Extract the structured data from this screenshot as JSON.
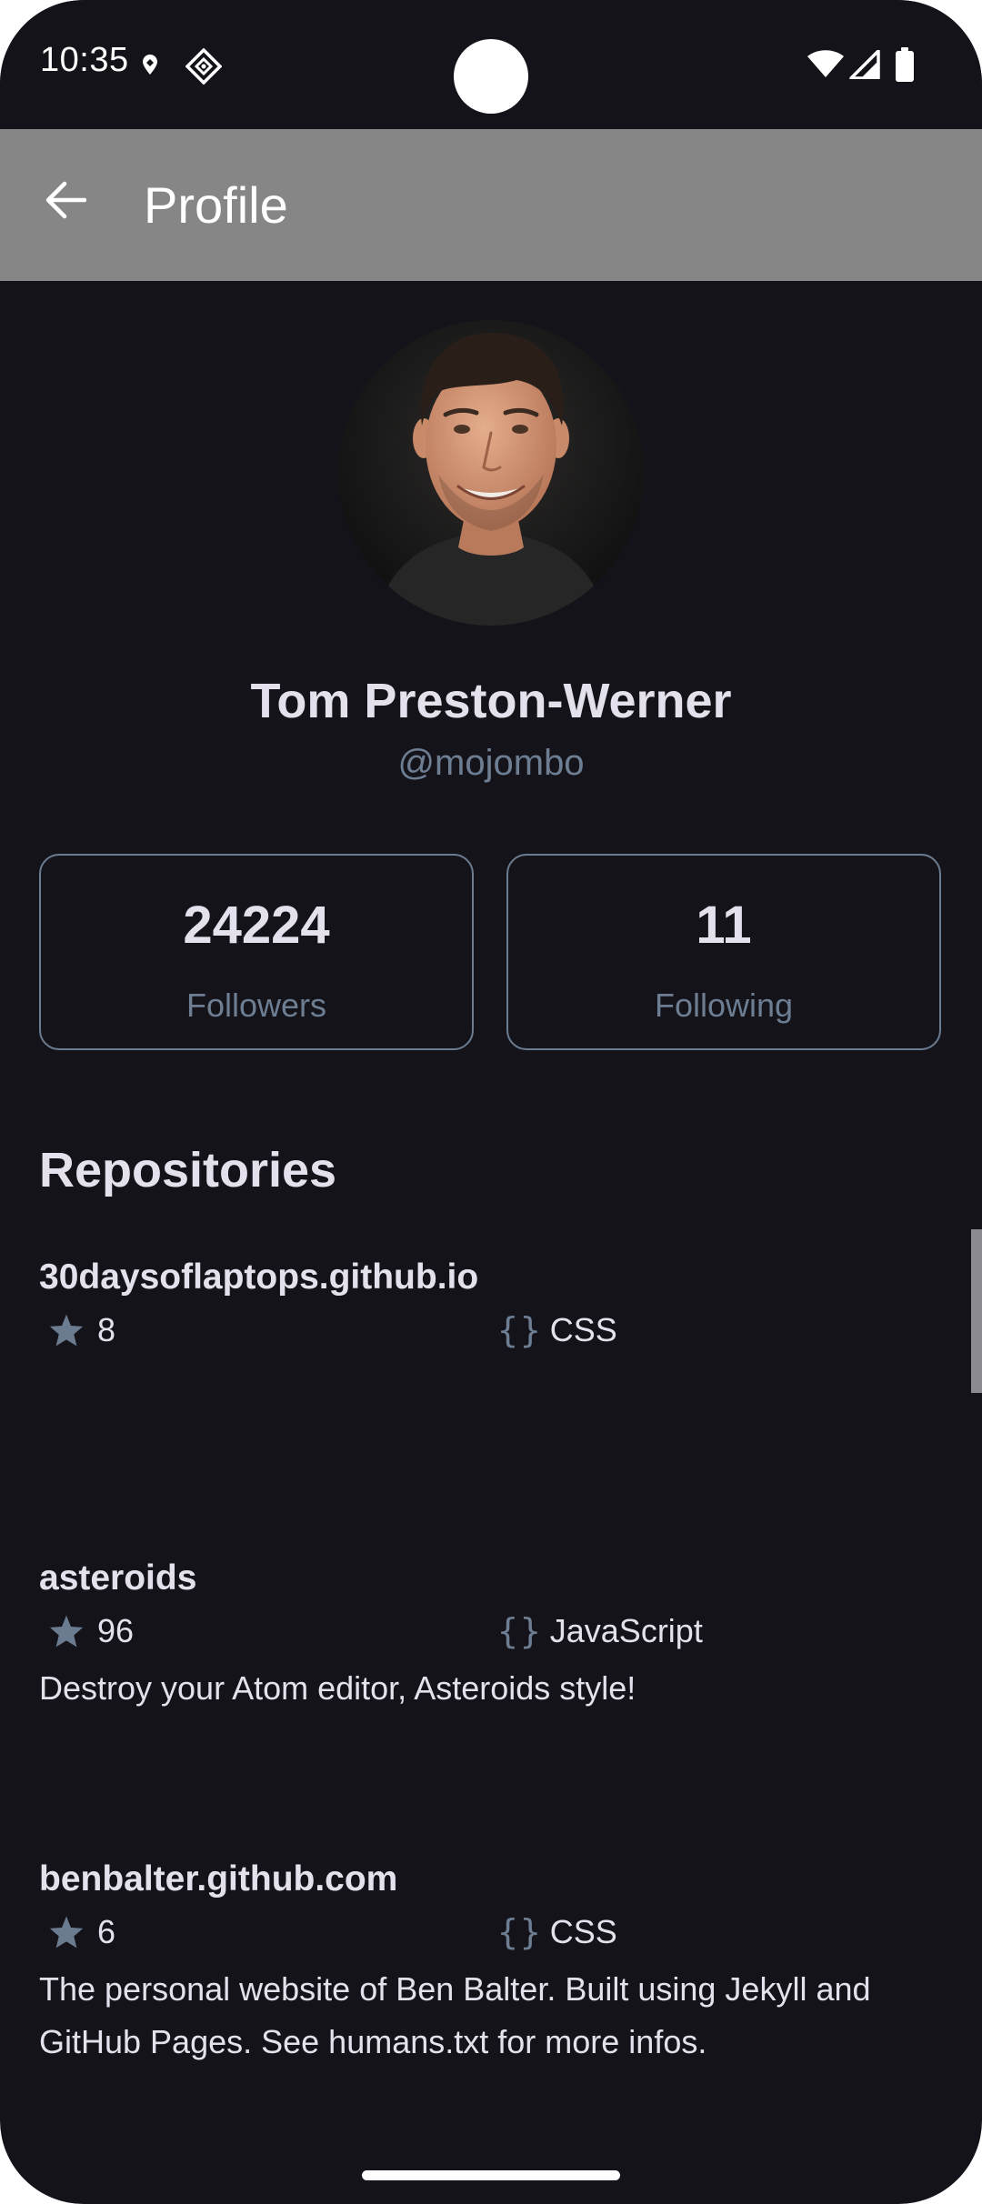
{
  "status_bar": {
    "time": "10:35",
    "icons": [
      "location-icon",
      "cast-icon",
      "wifi-icon",
      "signal-icon",
      "battery-icon"
    ]
  },
  "app_bar": {
    "title": "Profile",
    "back_icon": "arrow-back-icon"
  },
  "profile": {
    "name": "Tom Preston-Werner",
    "handle": "@mojombo"
  },
  "stats": [
    {
      "value": "24224",
      "label": "Followers"
    },
    {
      "value": "11",
      "label": "Following"
    }
  ],
  "repositories": {
    "title": "Repositories",
    "items": [
      {
        "name": "30daysoflaptops.github.io",
        "stars": "8",
        "language": "CSS",
        "description": ""
      },
      {
        "name": "asteroids",
        "stars": "96",
        "language": "JavaScript",
        "description": "Destroy your Atom editor, Asteroids style!"
      },
      {
        "name": "benbalter.github.com",
        "stars": "6",
        "language": "CSS",
        "description": "The personal website of Ben Balter. Built using Jekyll and GitHub Pages. See humans.txt for more infos."
      }
    ]
  },
  "colors": {
    "background": "#15131a",
    "app_bar": "#868686",
    "text_primary": "#e4e1ec",
    "text_secondary": "#6d7e92",
    "card_border": "#6b7c90"
  }
}
